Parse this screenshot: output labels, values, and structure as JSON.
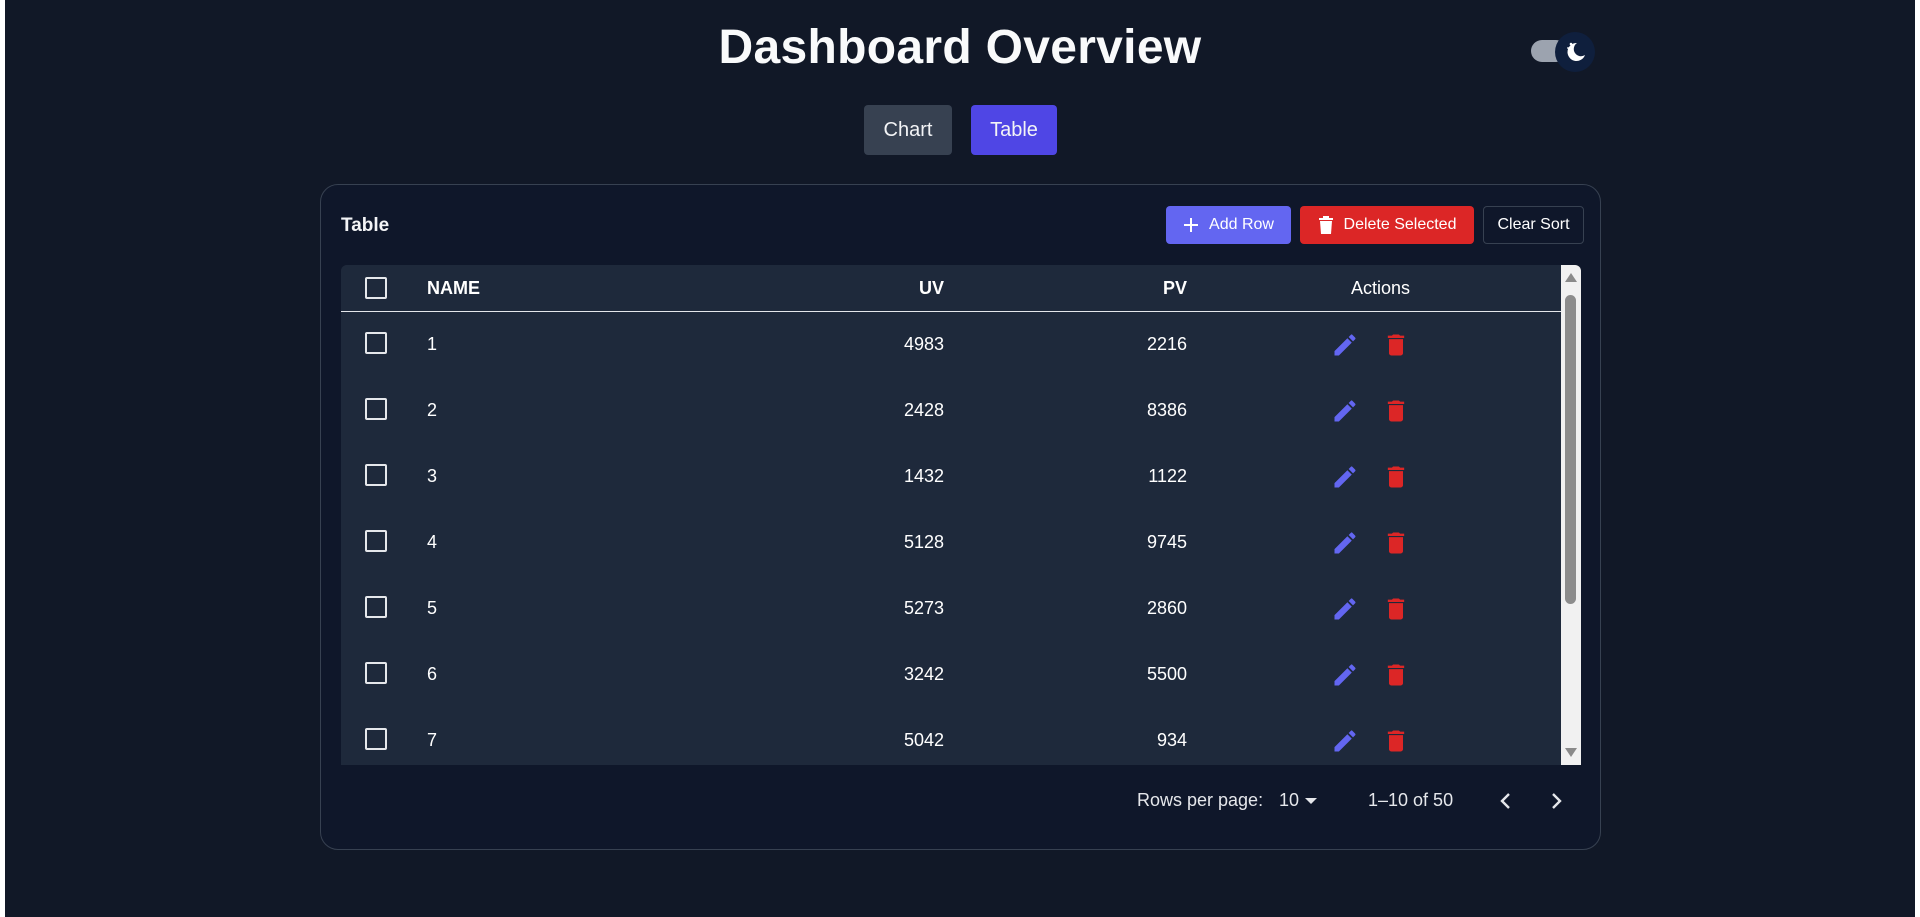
{
  "header": {
    "title": "Dashboard Overview"
  },
  "theme_toggle": {
    "mode": "dark",
    "icon": "moon-icon"
  },
  "view_tabs": [
    {
      "label": "Chart",
      "active": false
    },
    {
      "label": "Table",
      "active": true
    }
  ],
  "card": {
    "title": "Table",
    "actions": {
      "add_label": "Add Row",
      "delete_label": "Delete Selected",
      "clear_sort_label": "Clear Sort"
    }
  },
  "table": {
    "columns": {
      "name": "NAME",
      "uv": "UV",
      "pv": "PV",
      "actions": "Actions"
    },
    "rows": [
      {
        "name": "1",
        "uv": "4983",
        "pv": "2216"
      },
      {
        "name": "2",
        "uv": "2428",
        "pv": "8386"
      },
      {
        "name": "3",
        "uv": "1432",
        "pv": "1122"
      },
      {
        "name": "4",
        "uv": "5128",
        "pv": "9745"
      },
      {
        "name": "5",
        "uv": "5273",
        "pv": "2860"
      },
      {
        "name": "6",
        "uv": "3242",
        "pv": "5500"
      },
      {
        "name": "7",
        "uv": "5042",
        "pv": "934"
      }
    ]
  },
  "pagination": {
    "rows_per_page_label": "Rows per page:",
    "rows_per_page_value": "10",
    "range_text": "1–10 of 50"
  },
  "colors": {
    "background": "#111827",
    "primary": "#6366f1",
    "active_tab": "#4f46e5",
    "danger": "#dc2626"
  }
}
